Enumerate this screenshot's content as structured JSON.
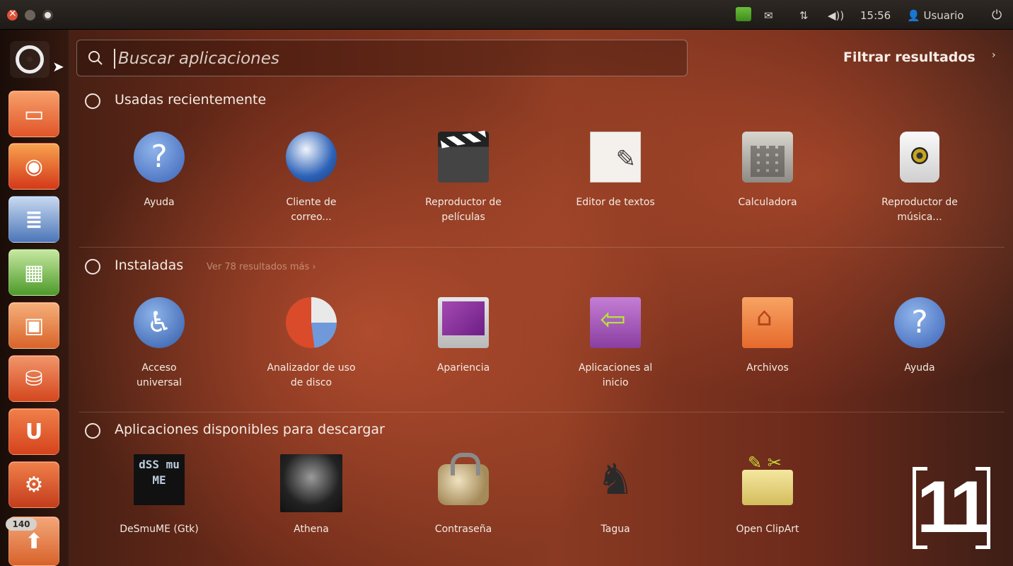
{
  "top_panel": {
    "clock": "15:56",
    "user": "Usuario",
    "icons": [
      "app-indicator-icon",
      "mail-icon",
      "network-icon",
      "volume-icon",
      "user-icon",
      "power-icon"
    ]
  },
  "launcher": {
    "items": [
      {
        "name": "dash-home",
        "icon": "ubuntu-logo-icon"
      },
      {
        "name": "files",
        "icon": "files-icon"
      },
      {
        "name": "firefox",
        "icon": "firefox-icon"
      },
      {
        "name": "libreoffice-writer",
        "icon": "writer-icon"
      },
      {
        "name": "libreoffice-calc",
        "icon": "calc-icon"
      },
      {
        "name": "libreoffice-impress",
        "icon": "impress-icon"
      },
      {
        "name": "software-center",
        "icon": "software-center-icon"
      },
      {
        "name": "ubuntu-one",
        "icon": "ubuntu-one-icon"
      },
      {
        "name": "system-settings",
        "icon": "settings-icon"
      },
      {
        "name": "updates",
        "icon": "update-icon"
      }
    ],
    "badge_count": "140",
    "ubuntu_one_glyph": "U"
  },
  "search": {
    "placeholder": "Buscar aplicaciones",
    "value": ""
  },
  "filter": {
    "label": "Filtrar resultados",
    "arrow": "›"
  },
  "sections": {
    "recent": {
      "title": "Usadas recientemente",
      "apps": [
        {
          "label": "Ayuda",
          "icon": "help-icon"
        },
        {
          "label": "Cliente de correo...",
          "icon": "mail-client-icon"
        },
        {
          "label": "Reproductor de películas",
          "icon": "movie-player-icon"
        },
        {
          "label": "Editor de textos",
          "icon": "text-editor-icon"
        },
        {
          "label": "Calculadora",
          "icon": "calculator-icon"
        },
        {
          "label": "Reproductor de música...",
          "icon": "music-player-icon"
        }
      ]
    },
    "installed": {
      "title": "Instaladas",
      "more": "Ver 78 resultados más  ›",
      "apps": [
        {
          "label": "Acceso universal",
          "icon": "accessibility-icon"
        },
        {
          "label": "Analizador de uso de disco",
          "icon": "disk-usage-icon"
        },
        {
          "label": "Apariencia",
          "icon": "appearance-icon"
        },
        {
          "label": "Aplicaciones al inicio",
          "icon": "startup-apps-icon"
        },
        {
          "label": "Archivos",
          "icon": "home-folder-icon"
        },
        {
          "label": "Ayuda",
          "icon": "help-icon"
        }
      ]
    },
    "download": {
      "title": "Aplicaciones disponibles para descargar",
      "apps": [
        {
          "label": "DeSmuME (Gtk)",
          "icon": "desmume-icon",
          "logo_text": "dSS mu ME"
        },
        {
          "label": "Athena",
          "icon": "athena-icon"
        },
        {
          "label": "Contraseña",
          "icon": "password-lock-icon"
        },
        {
          "label": "Tagua",
          "icon": "chess-knight-icon"
        },
        {
          "label": "Open ClipArt",
          "icon": "clipart-icon"
        }
      ]
    }
  },
  "page_badge": "11",
  "colors": {
    "accent_orange": "#e0552a",
    "background_dark": "#3a1c12",
    "panel": "#1e1a17",
    "text": "#f4ebe3",
    "border_yellow": "#e9c21a"
  }
}
